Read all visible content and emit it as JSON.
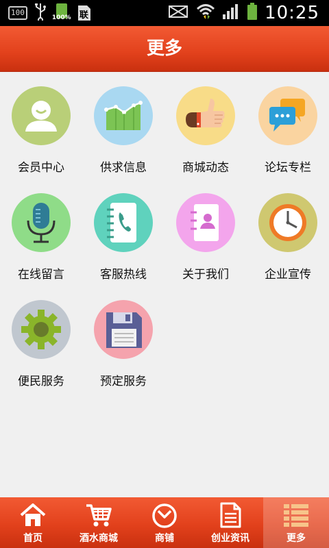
{
  "status_bar": {
    "badge": "100",
    "battery_percent": "100%",
    "sim_label": "联",
    "time": "10:25"
  },
  "header": {
    "title": "更多"
  },
  "menu": {
    "items": [
      {
        "label": "会员中心",
        "icon": "member-center-icon",
        "color": "#b9cf78"
      },
      {
        "label": "供求信息",
        "icon": "supply-demand-chart-icon",
        "color": "#a9d8f1"
      },
      {
        "label": "商城动态",
        "icon": "thumbs-up-icon",
        "color": "#f8dc88"
      },
      {
        "label": "论坛专栏",
        "icon": "chat-bubbles-icon",
        "color": "#fad4a0"
      },
      {
        "label": "在线留言",
        "icon": "microphone-icon",
        "color": "#8fdc88"
      },
      {
        "label": "客服热线",
        "icon": "phone-book-icon",
        "color": "#5fd2bd"
      },
      {
        "label": "关于我们",
        "icon": "contact-card-icon",
        "color": "#f3a5ec"
      },
      {
        "label": "企业宣传",
        "icon": "clock-icon",
        "color": "#cfc870"
      },
      {
        "label": "便民服务",
        "icon": "gear-icon",
        "color": "#c0c7cf"
      },
      {
        "label": "预定服务",
        "icon": "floppy-disk-icon",
        "color": "#f5a3ad"
      }
    ]
  },
  "tabs": [
    {
      "label": "首页",
      "icon": "home-icon"
    },
    {
      "label": "酒水商城",
      "icon": "cart-icon"
    },
    {
      "label": "商铺",
      "icon": "compass-icon"
    },
    {
      "label": "创业资讯",
      "icon": "document-icon"
    },
    {
      "label": "更多",
      "icon": "list-icon",
      "active": true
    }
  ]
}
